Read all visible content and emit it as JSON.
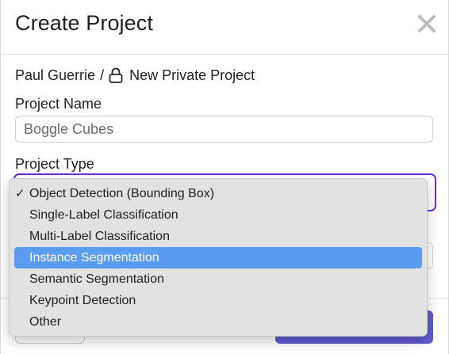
{
  "dialog": {
    "title": "Create Project",
    "close_icon": "close-icon"
  },
  "owner": {
    "user": "Paul Guerrie",
    "separator": "/",
    "visibility_icon": "lock-icon",
    "visibility_label": "New Private Project"
  },
  "project_name": {
    "label": "Project Name",
    "value": "Boggle Cubes"
  },
  "project_type": {
    "label": "Project Type",
    "selected": "Object Detection (Bounding Box)",
    "options": [
      {
        "label": "Object Detection (Bounding Box)",
        "checked": true,
        "highlighted": false
      },
      {
        "label": "Single-Label Classification",
        "checked": false,
        "highlighted": false
      },
      {
        "label": "Multi-Label Classification",
        "checked": false,
        "highlighted": false
      },
      {
        "label": "Instance Segmentation",
        "checked": false,
        "highlighted": true
      },
      {
        "label": "Semantic Segmentation",
        "checked": false,
        "highlighted": false
      },
      {
        "label": "Keypoint Detection",
        "checked": false,
        "highlighted": false
      },
      {
        "label": "Other",
        "checked": false,
        "highlighted": false
      }
    ],
    "checkmark": "✓"
  },
  "colors": {
    "focus_ring": "#6b2fd6",
    "highlight": "#5a9cf0",
    "primary_button": "#5f5cd1"
  }
}
